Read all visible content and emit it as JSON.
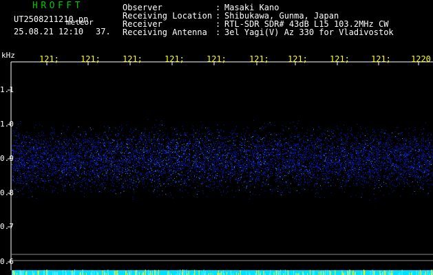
{
  "header_left": {
    "title": "HROFFT",
    "filename": "UT2508211210.pn",
    "type_label": "meteor",
    "datetime": "25.08.21 12:10",
    "signal_count": "37."
  },
  "station_info": [
    {
      "key": "Observer",
      "sep": ":",
      "value": "Masaki Kano"
    },
    {
      "key": "Receiving Location",
      "sep": ":",
      "value": "Shibukawa, Gunma, Japan"
    },
    {
      "key": "Receiver",
      "sep": ":",
      "value": "RTL-SDR SDR# 43dB L15 103.2MHz CW"
    },
    {
      "key": "Receiving Antenna",
      "sep": ":",
      "value": "3el Yagi(V) Az 330 for Vladivostok"
    }
  ],
  "axes": {
    "y_unit": "kHz",
    "x_ticks": [
      "121;",
      "121;",
      "121;",
      "121;",
      "121;",
      "121;",
      "121;",
      "121;",
      "121;",
      "1220"
    ],
    "y_ticks": [
      "1.1",
      "1.0",
      "0.9",
      "0.8",
      "0.7",
      "0.6"
    ]
  },
  "colors": {
    "background": "#000000",
    "text": "#ffffff",
    "time_labels": "#ffff00",
    "title": "#00c800",
    "noise": "#0a1ecc",
    "noise_bright": "#3aa0ff",
    "baseline": "#00e0ff"
  }
}
